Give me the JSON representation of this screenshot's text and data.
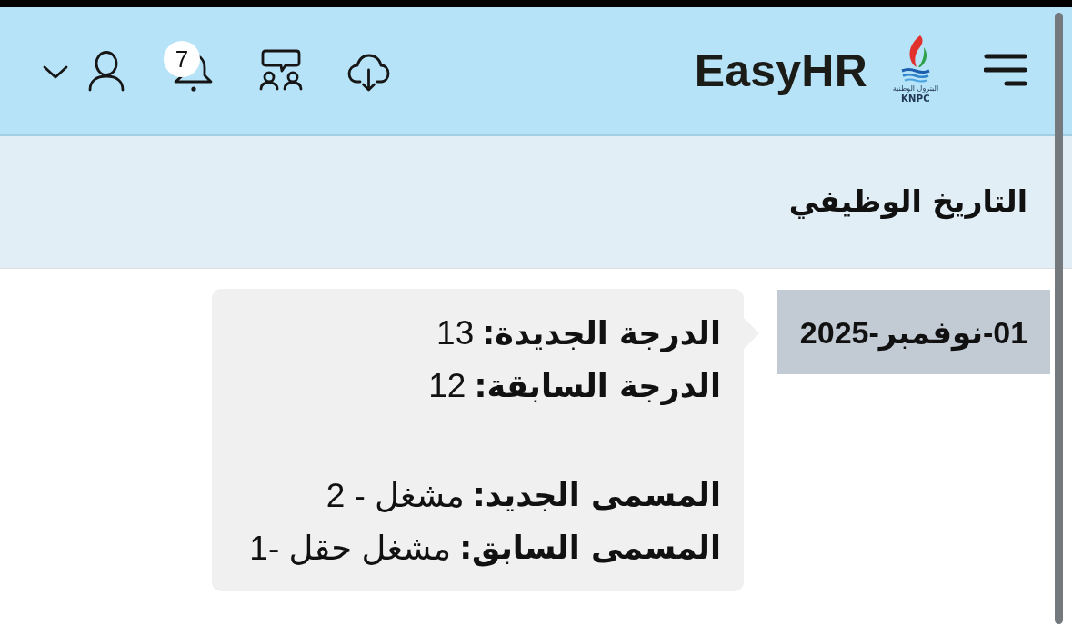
{
  "header": {
    "app_name": "EasyHR",
    "logo": {
      "caption_arabic": "البترول الوطنية",
      "caption": "KNPC"
    },
    "notifications": {
      "count": "7"
    }
  },
  "page": {
    "title": "التاريخ الوظيفي"
  },
  "history": [
    {
      "date": "01-نوفمبر-2025",
      "groups": [
        {
          "lines": [
            {
              "label": "الدرجة الجديدة:",
              "value": "13"
            },
            {
              "label": "الدرجة السابقة:",
              "value": "12"
            }
          ]
        },
        {
          "lines": [
            {
              "label": "المسمى الجديد:",
              "value": "مشغل - 2"
            },
            {
              "label": "المسمى السابق:",
              "value": "مشغل حقل -1"
            }
          ]
        }
      ]
    }
  ]
}
